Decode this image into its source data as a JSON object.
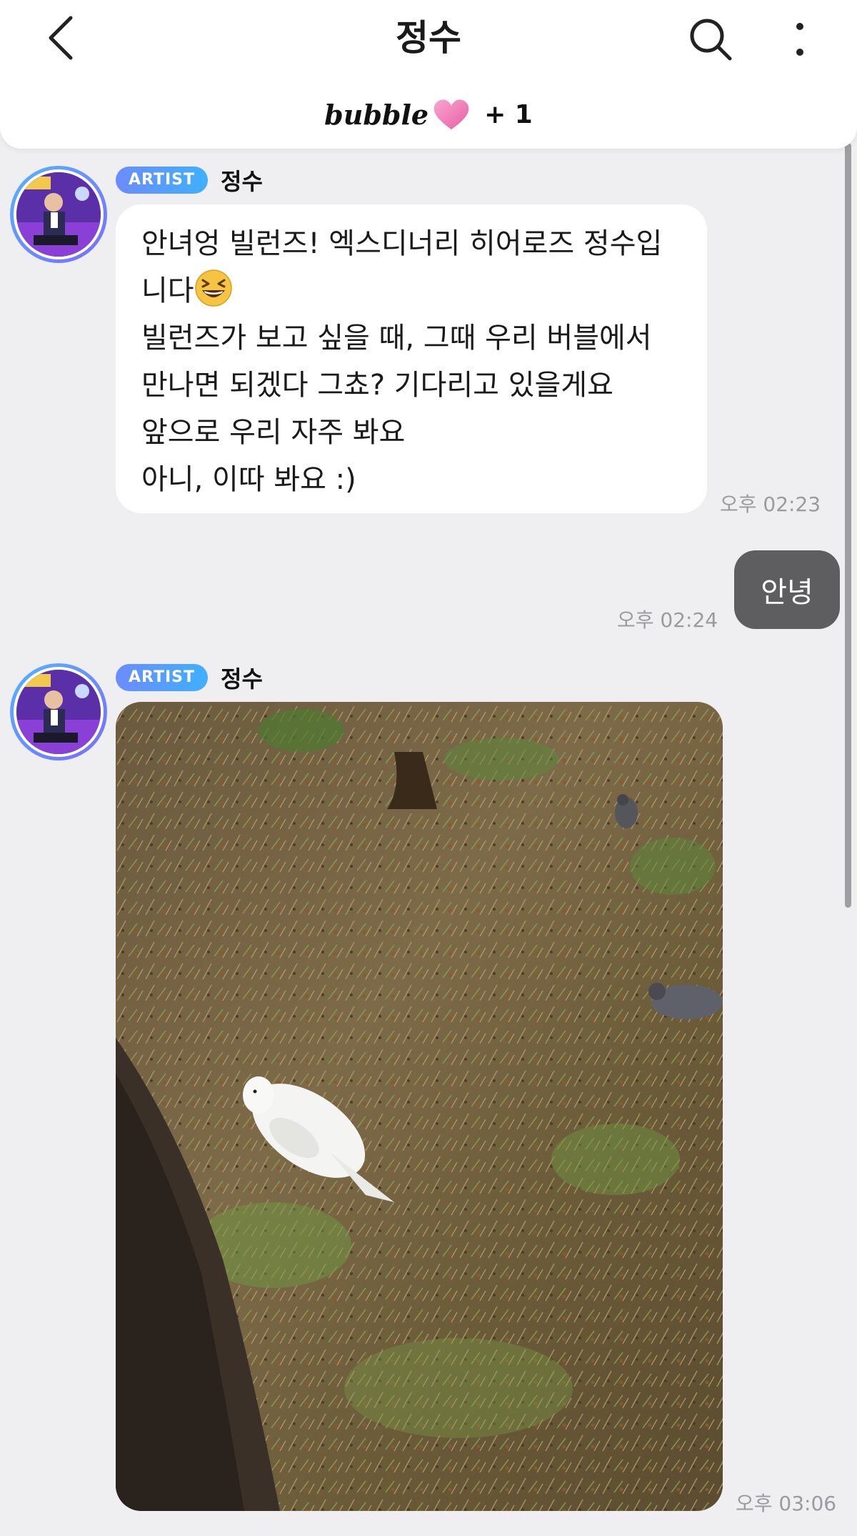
{
  "header": {
    "title": "정수",
    "bubble_logo": "bubble",
    "plus_count": "+ 1",
    "icons": [
      "back-arrow-icon",
      "search-icon",
      "more-vertical-icon",
      "heart-icon"
    ]
  },
  "colors": {
    "background": "#efeff1",
    "my_bubble": "#5e5e60",
    "artist_badge_start": "#6b8cff",
    "artist_badge_end": "#3fb0ff",
    "heart": "#f07ab5"
  },
  "messages": [
    {
      "badge": "ARTIST",
      "sender": "정수",
      "lines": [
        "안녀엉 빌런즈! 엑스디너리 히어로즈 정수입",
        "니다",
        "빌런즈가 보고 싶을 때, 그때 우리 버블에서",
        "만나면 되겠다 그쵸? 기다리고 있을게요",
        "앞으로 우리 자주 봐요",
        "아니, 이따 봐요 :)"
      ],
      "emoji": "grinning-squinting-face",
      "time": "오후 02:23"
    },
    {
      "text": "안녕",
      "time": "오후 02:24"
    },
    {
      "badge": "ARTIST",
      "sender": "정수",
      "photo": "white-dove-on-grass-photo",
      "time": "오후 03:06"
    }
  ]
}
